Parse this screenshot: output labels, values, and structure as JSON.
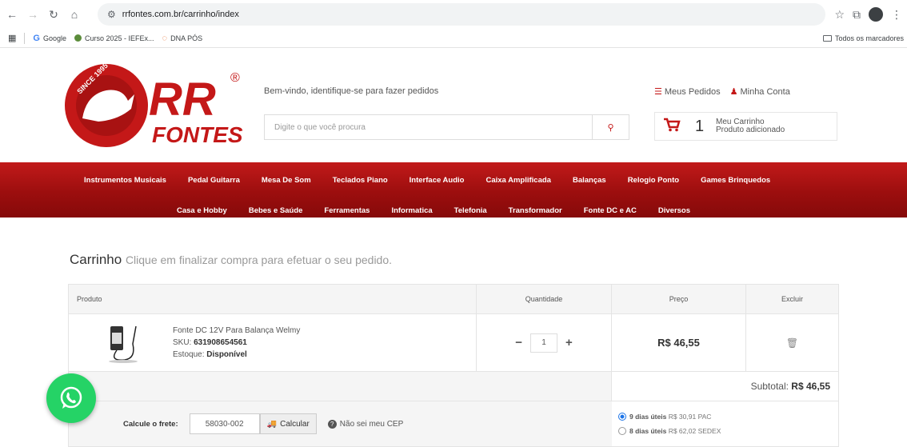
{
  "browser": {
    "url": "rrfontes.com.br/carrinho/index",
    "bookmarks": [
      "Google",
      "Curso 2025 - IEFEx...",
      "DNA PÓS"
    ],
    "all_bookmarks": "Todos os marcadores"
  },
  "header": {
    "logo_text_1": "RR",
    "logo_text_2": "FONTES",
    "logo_since": "SINCE 1995",
    "logo_registered": "®",
    "welcome": "Bem-vindo, identifique-se para fazer pedidos",
    "search_placeholder": "Digite o que você procura",
    "my_orders": "Meus Pedidos",
    "my_account": "Minha Conta",
    "cart_count": "1",
    "cart_title": "Meu Carrinho",
    "cart_subtitle": "Produto adicionado"
  },
  "categories_row1": [
    "Instrumentos Musicais",
    "Pedal Guitarra",
    "Mesa De Som",
    "Teclados Piano",
    "Interface Audio",
    "Caixa Amplificada",
    "Balanças",
    "Relogio Ponto",
    "Games Brinquedos"
  ],
  "categories_row2": [
    "Casa e Hobby",
    "Bebes e Saúde",
    "Ferramentas",
    "Informatica",
    "Telefonia",
    "Transformador",
    "Fonte DC e AC",
    "Diversos"
  ],
  "cart": {
    "title": "Carrinho",
    "subtitle": "Clique em finalizar compra para efetuar o seu pedido.",
    "headers": {
      "product": "Produto",
      "quantity": "Quantidade",
      "price": "Preço",
      "remove": "Excluir"
    },
    "item": {
      "name": "Fonte DC 12V Para Balança Welmy",
      "sku_label": "SKU:",
      "sku": "631908654561",
      "stock_label": "Estoque:",
      "stock": "Disponível",
      "qty": "1",
      "price": "R$ 46,55"
    },
    "subtotal_label": "Subtotal:",
    "subtotal": "R$ 46,55",
    "freight_label": "Calcule o frete:",
    "cep": "58030-002",
    "calc_button": "Calcular",
    "unknown_cep": "Não sei meu CEP",
    "options": [
      {
        "days": "9 dias úteis",
        "price": "R$ 30,91",
        "service": "PAC",
        "selected": true
      },
      {
        "days": "8 dias úteis",
        "price": "R$ 62,02",
        "service": "SEDEX",
        "selected": false
      }
    ]
  },
  "colors": {
    "brand_red": "#c41818",
    "whatsapp_green": "#25d366"
  }
}
